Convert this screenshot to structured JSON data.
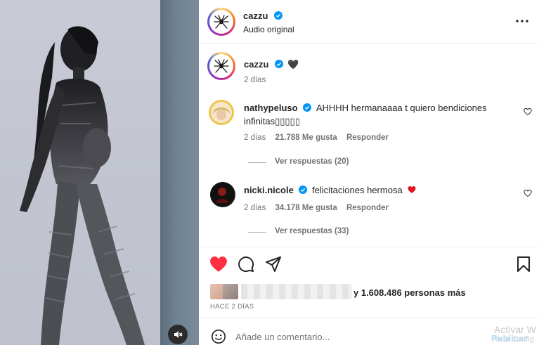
{
  "post": {
    "author": "cazzu",
    "audio": "Audio original",
    "caption_author": "cazzu",
    "caption_emoji": "🖤",
    "caption_time": "2 días"
  },
  "comments": [
    {
      "user": "nathypeluso",
      "text_line1": "AHHHH hermanaaaa t quiero bendiciones",
      "text_line2": "infinitas▯▯▯▯▯",
      "time": "2 días",
      "likes": "21.788 Me gusta",
      "reply": "Responder",
      "replies": "Ver respuestas (20)"
    },
    {
      "user": "nicki.nicole",
      "text": "felicitaciones hermosa",
      "time": "2 días",
      "likes": "34.178 Me gusta",
      "reply": "Responder",
      "replies": "Ver respuestas (33)"
    }
  ],
  "likes_summary": "y 1.608.486 personas más",
  "posted_ago": "HACE 2 DÍAS",
  "comment_input": {
    "placeholder": "Añade un comentario..."
  },
  "publish_label": "Publicar",
  "os_watermark": {
    "line1": "Activar W",
    "line2": "Ve a Config"
  },
  "colors": {
    "verified": "#0095f6",
    "liked_heart": "#ff3040",
    "publish": "#b2dffc"
  },
  "icons": [
    "more-options-icon",
    "heart-icon",
    "comment-icon",
    "share-icon",
    "bookmark-icon",
    "emoji-icon",
    "mute-icon",
    "verified-badge-icon"
  ]
}
